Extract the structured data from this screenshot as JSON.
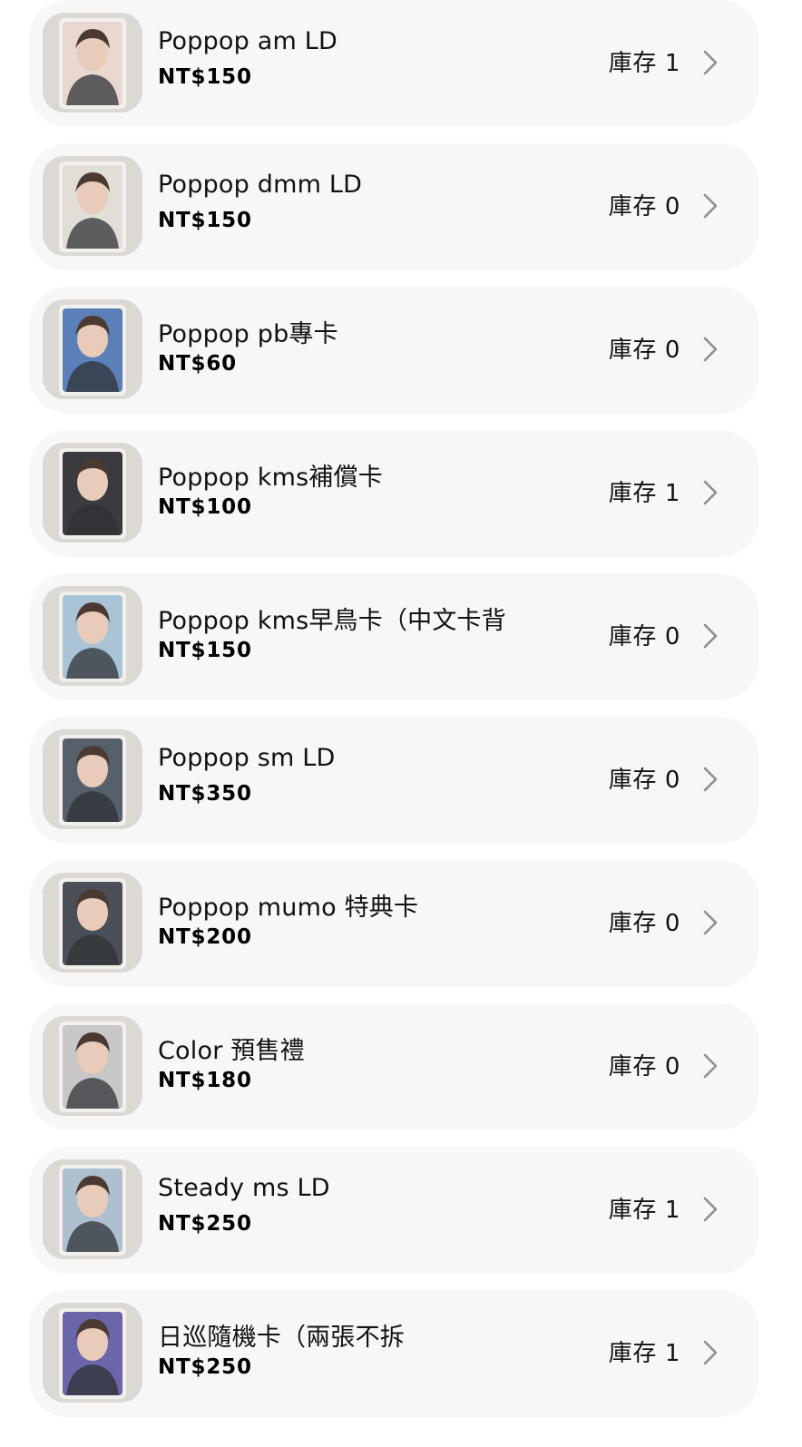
{
  "products": [
    {
      "name": "Poppop am LD",
      "price": "NT$150",
      "stock": "庫存 1",
      "thumb": "photocard-thumbnail",
      "tone": "#e9d8cf"
    },
    {
      "name": "Poppop dmm LD",
      "price": "NT$150",
      "stock": "庫存 0",
      "thumb": "photocard-thumbnail",
      "tone": "#e2ddd6"
    },
    {
      "name": "Poppop pb專卡",
      "price": "NT$60",
      "stock": "庫存 0",
      "thumb": "photocard-thumbnail",
      "tone": "#5b7fb8"
    },
    {
      "name": "Poppop kms補償卡",
      "price": "NT$100",
      "stock": "庫存 1",
      "thumb": "photocard-thumbnail",
      "tone": "#3a3a3f"
    },
    {
      "name": "Poppop kms早鳥卡（中文卡背",
      "price": "NT$150",
      "stock": "庫存 0",
      "thumb": "photocard-thumbnail",
      "tone": "#a9c4d6"
    },
    {
      "name": "Poppop sm LD",
      "price": "NT$350",
      "stock": "庫存 0",
      "thumb": "photocard-thumbnail",
      "tone": "#55606b"
    },
    {
      "name": "Poppop mumo 特典卡",
      "price": "NT$200",
      "stock": "庫存 0",
      "thumb": "photocard-thumbnail",
      "tone": "#4b4f57"
    },
    {
      "name": "Color 預售禮",
      "price": "NT$180",
      "stock": "庫存 0",
      "thumb": "photocard-thumbnail",
      "tone": "#c9c6c8"
    },
    {
      "name": "Steady ms LD",
      "price": "NT$250",
      "stock": "庫存 1",
      "thumb": "photocard-thumbnail",
      "tone": "#aebfcf"
    },
    {
      "name": "日巡隨機卡（兩張不拆",
      "price": "NT$250",
      "stock": "庫存 1",
      "thumb": "photocard-thumbnail",
      "tone": "#6a66a8"
    }
  ],
  "colors": {
    "row_background": "#f7f7f7",
    "chevron": "#8e8e93",
    "text": "#111111"
  }
}
